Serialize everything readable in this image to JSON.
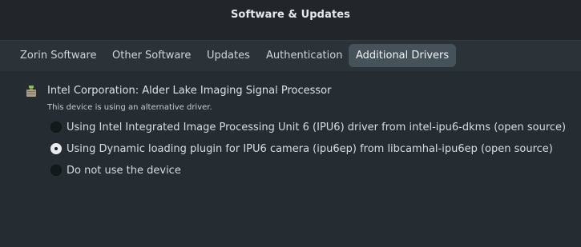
{
  "window": {
    "title": "Software & Updates"
  },
  "tabs": [
    {
      "label": "Zorin Software",
      "active": false
    },
    {
      "label": "Other Software",
      "active": false
    },
    {
      "label": "Updates",
      "active": false
    },
    {
      "label": "Authentication",
      "active": false
    },
    {
      "label": "Additional Drivers",
      "active": true
    }
  ],
  "device": {
    "icon": "chip-device-icon",
    "name": "Intel Corporation: Alder Lake Imaging Signal Processor",
    "note": "This device is using an alternative driver.",
    "options": [
      {
        "label": "Using Intel Integrated Image Processing Unit 6 (IPU6) driver from intel-ipu6-dkms (open source)",
        "selected": false
      },
      {
        "label": "Using Dynamic loading plugin for IPU6 camera (ipu6ep) from libcamhal-ipu6ep (open source)",
        "selected": true
      },
      {
        "label": "Do not use the device",
        "selected": false
      }
    ]
  },
  "colors": {
    "window_bg": "#20262a",
    "tabbar_bg": "#2c3338",
    "active_tab_bg": "#46525a",
    "content_bg": "#262d32",
    "text": "#d8dcdf"
  }
}
